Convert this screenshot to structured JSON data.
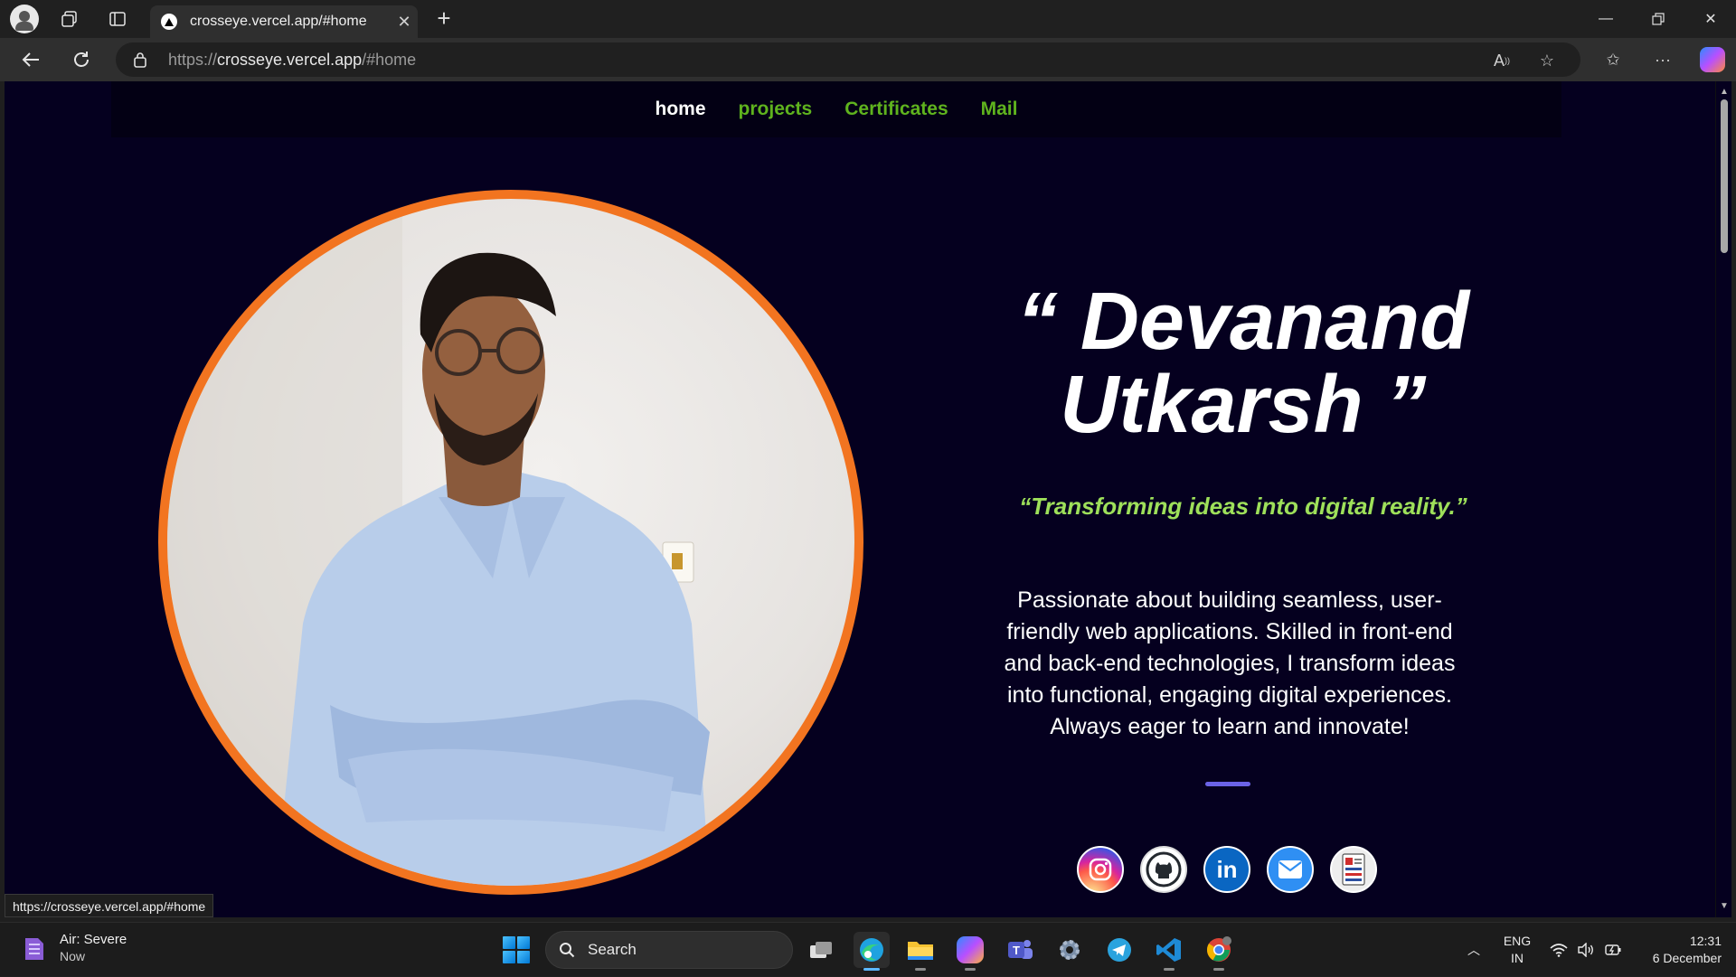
{
  "browser": {
    "tab_title": "crosseye.vercel.app/#home",
    "url_prefix": "https://",
    "url_host": "crosseye.vercel.app",
    "url_path": "/#home",
    "status_url": "https://crosseye.vercel.app/#home"
  },
  "site": {
    "nav": [
      "home",
      "projects",
      "Certificates",
      "Mail"
    ],
    "name_line1": "“ Devanand",
    "name_line2": "Utkarsh ”",
    "tagline": "“Transforming ideas into digital reality.”",
    "bio": "Passionate about building seamless, user-friendly web applications. Skilled in front-end and back-end technologies, I transform ideas into functional, engaging digital experiences. Always eager to learn and innovate!",
    "socials": [
      "instagram-icon",
      "github-icon",
      "linkedin-icon",
      "mail-icon",
      "resume-icon"
    ],
    "colors": {
      "background": "#05001f",
      "accent_ring": "#f27420",
      "nav_link": "#5fb31e",
      "tagline": "#9ee05a",
      "divider": "#6b63e6"
    }
  },
  "taskbar": {
    "weather_title": "Air: Severe",
    "weather_sub": "Now",
    "search_label": "Search",
    "lang_top": "ENG",
    "lang_bottom": "IN",
    "time": "12:31",
    "date": "6 December"
  }
}
